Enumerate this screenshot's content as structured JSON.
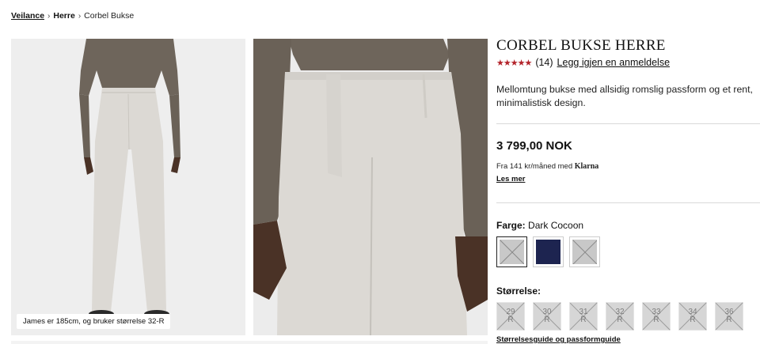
{
  "breadcrumb": {
    "items": [
      "Veilance",
      "Herre",
      "Corbel Bukse"
    ]
  },
  "gallery": {
    "caption": "James er 185cm, og bruker størrelse 32-R"
  },
  "product": {
    "title": "CORBEL BUKSE HERRE",
    "rating_stars": "★★★★★",
    "rating_value": 5,
    "review_count": "(14)",
    "review_link": "Legg igjen en anmeldelse",
    "description": "Mellomtung bukse med allsidig romslig passform og et rent, minimalistisk design.",
    "price": "3 799,00 NOK",
    "klarna_text": "Fra 141 kr/måned med",
    "klarna_brand": "Klarna",
    "read_more": "Les mer",
    "color_label": "Farge:",
    "color_value": "Dark Cocoon",
    "swatches": [
      {
        "name": "Dark Cocoon",
        "selected": true,
        "color": "#c8c8c8"
      },
      {
        "name": "navy",
        "selected": false,
        "color": "#1d2450"
      },
      {
        "name": "grey",
        "selected": false,
        "color": "#c8c8c8"
      }
    ],
    "size_label": "Størrelse:",
    "sizes": [
      {
        "num": "29",
        "fit": "R"
      },
      {
        "num": "30",
        "fit": "R"
      },
      {
        "num": "31",
        "fit": "R"
      },
      {
        "num": "32",
        "fit": "R"
      },
      {
        "num": "33",
        "fit": "R"
      },
      {
        "num": "34",
        "fit": "R"
      },
      {
        "num": "36",
        "fit": "R"
      }
    ],
    "size_guide": "Størrelsesguide og passformguide"
  },
  "colors": {
    "star": "#b3232a",
    "navy": "#1d2450",
    "pants": "#dcd9d4",
    "shirt": "#6e655b"
  }
}
